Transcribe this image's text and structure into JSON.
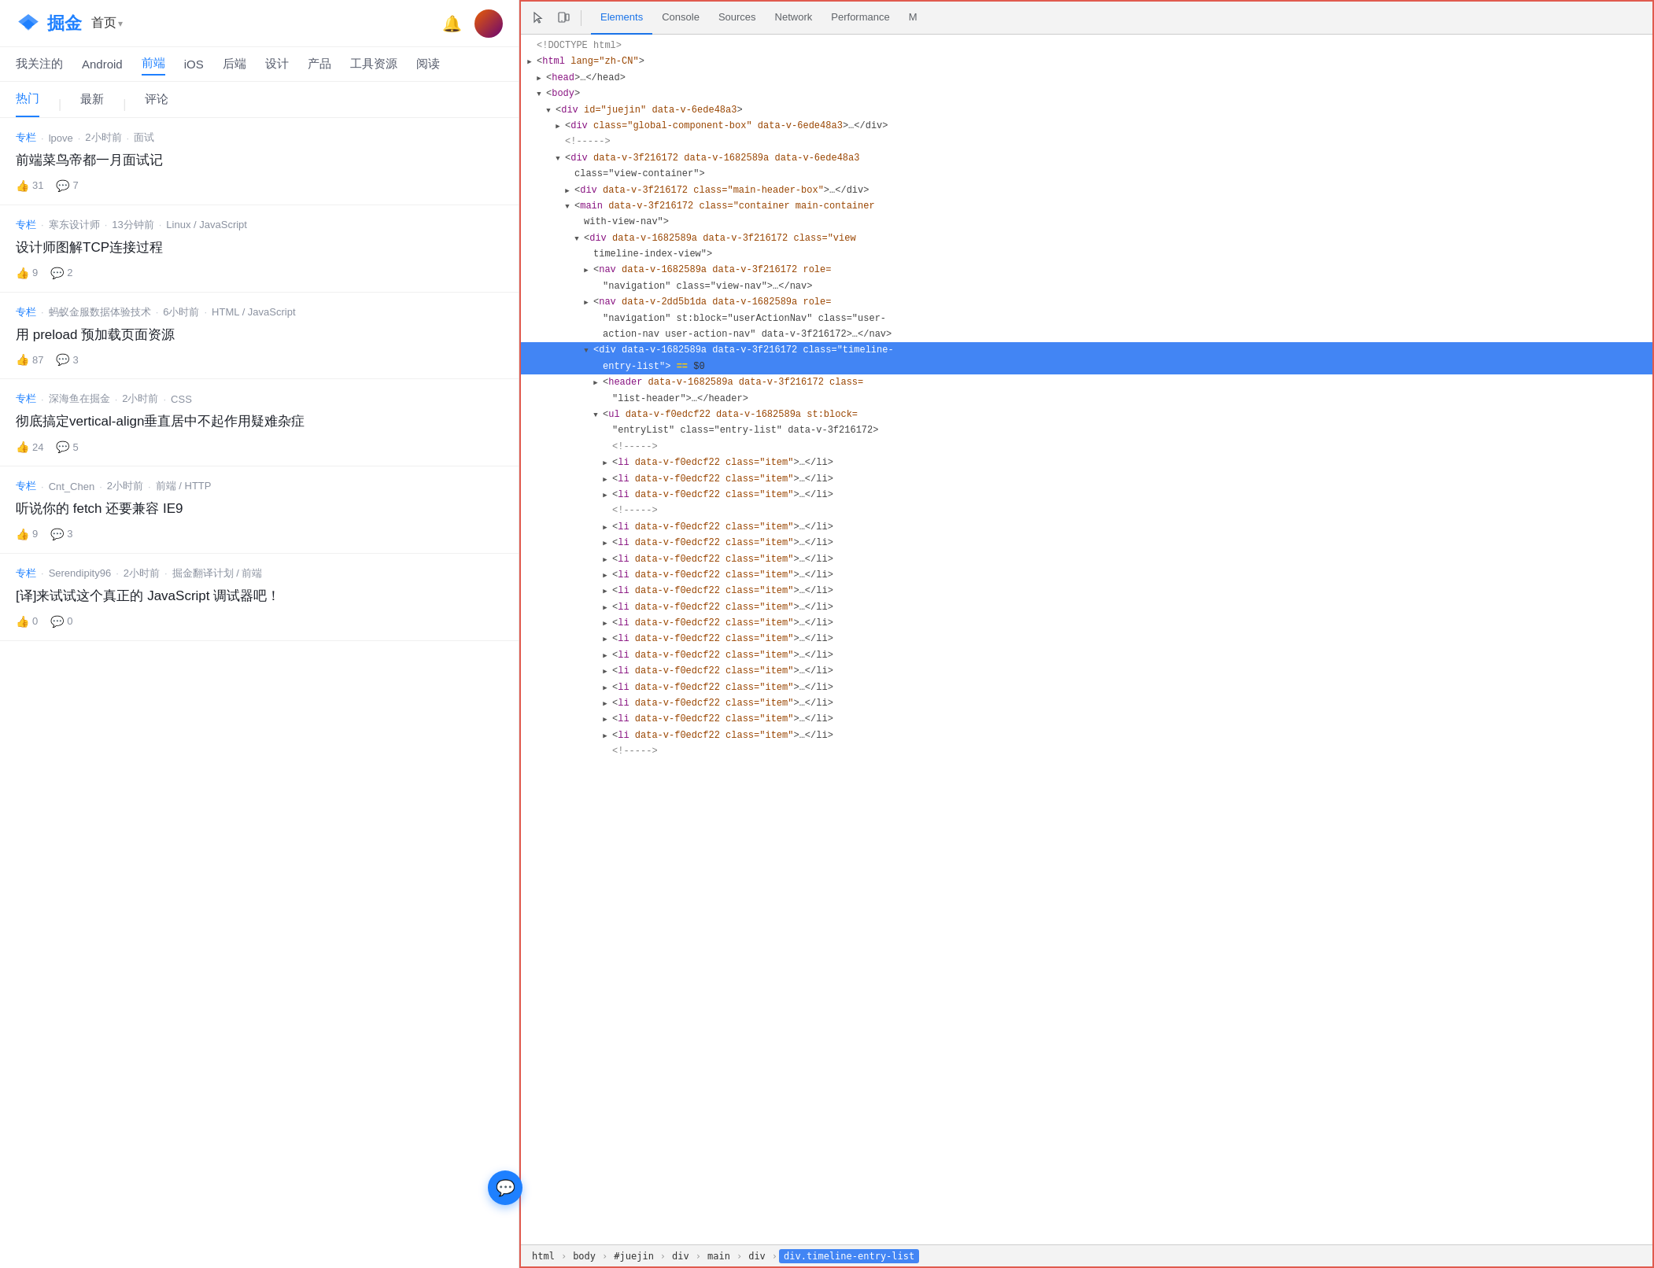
{
  "site": {
    "name": "掘金",
    "homeLabel": "首页",
    "homeArrow": "▾"
  },
  "categories": [
    {
      "label": "我关注的",
      "active": false
    },
    {
      "label": "Android",
      "active": false
    },
    {
      "label": "前端",
      "active": true
    },
    {
      "label": "iOS",
      "active": false
    },
    {
      "label": "后端",
      "active": false
    },
    {
      "label": "设计",
      "active": false
    },
    {
      "label": "产品",
      "active": false
    },
    {
      "label": "工具资源",
      "active": false
    },
    {
      "label": "阅读",
      "active": false
    }
  ],
  "tabs": [
    {
      "label": "热门",
      "active": true
    },
    {
      "label": "最新",
      "active": false
    },
    {
      "label": "评论",
      "active": false
    }
  ],
  "articles": [
    {
      "tag": "专栏",
      "author": "lpove",
      "time": "2小时前",
      "category": "面试",
      "title": "前端菜鸟帝都一月面试记",
      "likes": 31,
      "comments": 7
    },
    {
      "tag": "专栏",
      "author": "寒东设计师",
      "time": "13分钟前",
      "category": "Linux / JavaScript",
      "title": "设计师图解TCP连接过程",
      "likes": 9,
      "comments": 2
    },
    {
      "tag": "专栏",
      "author": "蚂蚁金服数据体验技术",
      "time": "6小时前",
      "category": "HTML / JavaScript",
      "title": "用 preload 预加载页面资源",
      "likes": 87,
      "comments": 3
    },
    {
      "tag": "专栏",
      "author": "深海鱼在掘金",
      "time": "2小时前",
      "category": "CSS",
      "title": "彻底搞定vertical-align垂直居中不起作用疑难杂症",
      "likes": 24,
      "comments": 5
    },
    {
      "tag": "专栏",
      "author": "Cnt_Chen",
      "time": "2小时前",
      "category": "前端 / HTTP",
      "title": "听说你的 fetch 还要兼容 IE9",
      "likes": 9,
      "comments": 3
    },
    {
      "tag": "专栏",
      "author": "Serendipity96",
      "time": "2小时前",
      "category": "掘金翻译计划 / 前端",
      "title": "[译]来试试这个真正的 JavaScript 调试器吧！",
      "likes": 0,
      "comments": 0
    }
  ],
  "devtools": {
    "tabs": [
      {
        "label": "Elements",
        "active": true
      },
      {
        "label": "Console",
        "active": false
      },
      {
        "label": "Sources",
        "active": false
      },
      {
        "label": "Network",
        "active": false
      },
      {
        "label": "Performance",
        "active": false
      },
      {
        "label": "M",
        "active": false
      }
    ],
    "dom_lines": [
      {
        "indent": 0,
        "triangle": "leaf",
        "content": "<!DOCTYPE html>",
        "type": "comment",
        "selected": false
      },
      {
        "indent": 0,
        "triangle": "closed",
        "content_before": "<",
        "tag": "html",
        "attrs": " lang=\"zh-CN\"",
        "content_after": ">",
        "type": "tag",
        "selected": false
      },
      {
        "indent": 1,
        "triangle": "closed",
        "content_before": "<",
        "tag": "head",
        "attrs": "",
        "content_after": ">…</head>",
        "type": "tag",
        "selected": false
      },
      {
        "indent": 1,
        "triangle": "open",
        "content_before": "<",
        "tag": "body",
        "attrs": "",
        "content_after": ">",
        "type": "tag",
        "selected": false
      },
      {
        "indent": 2,
        "triangle": "open",
        "content_before": "<",
        "tag": "div",
        "attrs": " id=\"juejin\" data-v-6ede48a3",
        "content_after": ">",
        "type": "tag",
        "selected": false
      },
      {
        "indent": 3,
        "triangle": "closed",
        "content_before": "<",
        "tag": "div",
        "attrs": " class=\"global-component-box\" data-v-6ede48a3",
        "content_after": ">…</div>",
        "type": "tag",
        "selected": false
      },
      {
        "indent": 3,
        "triangle": "leaf",
        "content": "<!----->",
        "type": "comment",
        "selected": false
      },
      {
        "indent": 3,
        "triangle": "open",
        "content_before": "<",
        "tag": "div",
        "attrs": " data-v-3f216172 data-v-1682589a data-v-6ede48a3",
        "content_after": "",
        "type": "tag",
        "selected": false
      },
      {
        "indent": 4,
        "triangle": "leaf",
        "content": "class=\"view-container\">",
        "type": "raw",
        "selected": false
      },
      {
        "indent": 4,
        "triangle": "closed",
        "content_before": "<",
        "tag": "div",
        "attrs": " data-v-3f216172 class=\"main-header-box\"",
        "content_after": ">…</div>",
        "type": "tag",
        "selected": false
      },
      {
        "indent": 4,
        "triangle": "open",
        "content_before": "<",
        "tag": "main",
        "attrs": " data-v-3f216172 class=\"container main-container",
        "content_after": "",
        "type": "tag",
        "selected": false
      },
      {
        "indent": 5,
        "triangle": "leaf",
        "content": "with-view-nav\">",
        "type": "raw",
        "selected": false
      },
      {
        "indent": 5,
        "triangle": "open",
        "content_before": "<",
        "tag": "div",
        "attrs": " data-v-1682589a data-v-3f216172 class=\"view",
        "content_after": "",
        "type": "tag",
        "selected": false
      },
      {
        "indent": 6,
        "triangle": "leaf",
        "content": "timeline-index-view\">",
        "type": "raw",
        "selected": false
      },
      {
        "indent": 6,
        "triangle": "closed",
        "content_before": "<",
        "tag": "nav",
        "attrs": " data-v-1682589a data-v-3f216172 role=",
        "content_after": "",
        "type": "tag",
        "selected": false
      },
      {
        "indent": 7,
        "triangle": "leaf",
        "content": "\"navigation\" class=\"view-nav\">…</nav>",
        "type": "raw",
        "selected": false
      },
      {
        "indent": 6,
        "triangle": "closed",
        "content_before": "<",
        "tag": "nav",
        "attrs": " data-v-2dd5b1da data-v-1682589a role=",
        "content_after": "",
        "type": "tag",
        "selected": false
      },
      {
        "indent": 7,
        "triangle": "leaf",
        "content": "\"navigation\" st:block=\"userActionNav\" class=\"user-",
        "type": "raw",
        "selected": false
      },
      {
        "indent": 7,
        "triangle": "leaf",
        "content": "action-nav user-action-nav\" data-v-3f216172>…</nav>",
        "type": "raw",
        "selected": false
      },
      {
        "indent": 6,
        "triangle": "open",
        "content_before": "<",
        "tag": "div",
        "attrs": " data-v-1682589a data-v-3f216172 class=\"timeline-",
        "content_after": "",
        "type": "tag",
        "selected": true
      },
      {
        "indent": 7,
        "triangle": "leaf",
        "content": "entry-list\"> == $0",
        "type": "selected-marker",
        "selected": true
      },
      {
        "indent": 7,
        "triangle": "closed",
        "content_before": "<",
        "tag": "header",
        "attrs": " data-v-1682589a data-v-3f216172 class=",
        "content_after": "",
        "type": "tag",
        "selected": false
      },
      {
        "indent": 8,
        "triangle": "leaf",
        "content": "\"list-header\">…</header>",
        "type": "raw",
        "selected": false
      },
      {
        "indent": 7,
        "triangle": "open",
        "content_before": "<",
        "tag": "ul",
        "attrs": " data-v-f0edcf22 data-v-1682589a st:block=",
        "content_after": "",
        "type": "tag",
        "selected": false
      },
      {
        "indent": 8,
        "triangle": "leaf",
        "content": "\"entryList\" class=\"entry-list\" data-v-3f216172>",
        "type": "raw",
        "selected": false
      },
      {
        "indent": 8,
        "triangle": "leaf",
        "content": "<!----->",
        "type": "comment",
        "selected": false
      },
      {
        "indent": 8,
        "triangle": "closed",
        "content_before": "<",
        "tag": "li",
        "attrs": " data-v-f0edcf22 class=\"item\"",
        "content_after": ">…</li>",
        "type": "tag",
        "selected": false
      },
      {
        "indent": 8,
        "triangle": "closed",
        "content_before": "<",
        "tag": "li",
        "attrs": " data-v-f0edcf22 class=\"item\"",
        "content_after": ">…</li>",
        "type": "tag",
        "selected": false
      },
      {
        "indent": 8,
        "triangle": "closed",
        "content_before": "<",
        "tag": "li",
        "attrs": " data-v-f0edcf22 class=\"item\"",
        "content_after": ">…</li>",
        "type": "tag",
        "selected": false
      },
      {
        "indent": 8,
        "triangle": "leaf",
        "content": "<!----->",
        "type": "comment",
        "selected": false
      },
      {
        "indent": 8,
        "triangle": "closed",
        "content_before": "<",
        "tag": "li",
        "attrs": " data-v-f0edcf22 class=\"item\"",
        "content_after": ">…</li>",
        "type": "tag",
        "selected": false
      },
      {
        "indent": 8,
        "triangle": "closed",
        "content_before": "<",
        "tag": "li",
        "attrs": " data-v-f0edcf22 class=\"item\"",
        "content_after": ">…</li>",
        "type": "tag",
        "selected": false
      },
      {
        "indent": 8,
        "triangle": "closed",
        "content_before": "<",
        "tag": "li",
        "attrs": " data-v-f0edcf22 class=\"item\"",
        "content_after": ">…</li>",
        "type": "tag",
        "selected": false
      },
      {
        "indent": 8,
        "triangle": "closed",
        "content_before": "<",
        "tag": "li",
        "attrs": " data-v-f0edcf22 class=\"item\"",
        "content_after": ">…</li>",
        "type": "tag",
        "selected": false
      },
      {
        "indent": 8,
        "triangle": "closed",
        "content_before": "<",
        "tag": "li",
        "attrs": " data-v-f0edcf22 class=\"item\"",
        "content_after": ">…</li>",
        "type": "tag",
        "selected": false
      },
      {
        "indent": 8,
        "triangle": "closed",
        "content_before": "<",
        "tag": "li",
        "attrs": " data-v-f0edcf22 class=\"item\"",
        "content_after": ">…</li>",
        "type": "tag",
        "selected": false
      },
      {
        "indent": 8,
        "triangle": "closed",
        "content_before": "<",
        "tag": "li",
        "attrs": " data-v-f0edcf22 class=\"item\"",
        "content_after": ">…</li>",
        "type": "tag",
        "selected": false
      },
      {
        "indent": 8,
        "triangle": "closed",
        "content_before": "<",
        "tag": "li",
        "attrs": " data-v-f0edcf22 class=\"item\"",
        "content_after": ">…</li>",
        "type": "tag",
        "selected": false
      },
      {
        "indent": 8,
        "triangle": "closed",
        "content_before": "<",
        "tag": "li",
        "attrs": " data-v-f0edcf22 class=\"item\"",
        "content_after": ">…</li>",
        "type": "tag",
        "selected": false
      },
      {
        "indent": 8,
        "triangle": "closed",
        "content_before": "<",
        "tag": "li",
        "attrs": " data-v-f0edcf22 class=\"item\"",
        "content_after": ">…</li>",
        "type": "tag",
        "selected": false
      },
      {
        "indent": 8,
        "triangle": "closed",
        "content_before": "<",
        "tag": "li",
        "attrs": " data-v-f0edcf22 class=\"item\"",
        "content_after": ">…</li>",
        "type": "tag",
        "selected": false
      },
      {
        "indent": 8,
        "triangle": "closed",
        "content_before": "<",
        "tag": "li",
        "attrs": " data-v-f0edcf22 class=\"item\"",
        "content_after": ">…</li>",
        "type": "tag",
        "selected": false
      },
      {
        "indent": 8,
        "triangle": "closed",
        "content_before": "<",
        "tag": "li",
        "attrs": " data-v-f0edcf22 class=\"item\"",
        "content_after": ">…</li>",
        "type": "tag",
        "selected": false
      },
      {
        "indent": 8,
        "triangle": "closed",
        "content_before": "<",
        "tag": "li",
        "attrs": " data-v-f0edcf22 class=\"item\"",
        "content_after": ">…</li>",
        "type": "tag",
        "selected": false
      },
      {
        "indent": 8,
        "triangle": "leaf",
        "content": "<!----->",
        "type": "comment",
        "selected": false
      }
    ],
    "breadcrumb": [
      {
        "label": "html",
        "active": false
      },
      {
        "label": "body",
        "active": false
      },
      {
        "label": "#juejin",
        "active": false
      },
      {
        "label": "div",
        "active": false
      },
      {
        "label": "main",
        "active": false
      },
      {
        "label": "div",
        "active": false
      },
      {
        "label": "div.timeline-entry-list",
        "active": true
      }
    ]
  }
}
